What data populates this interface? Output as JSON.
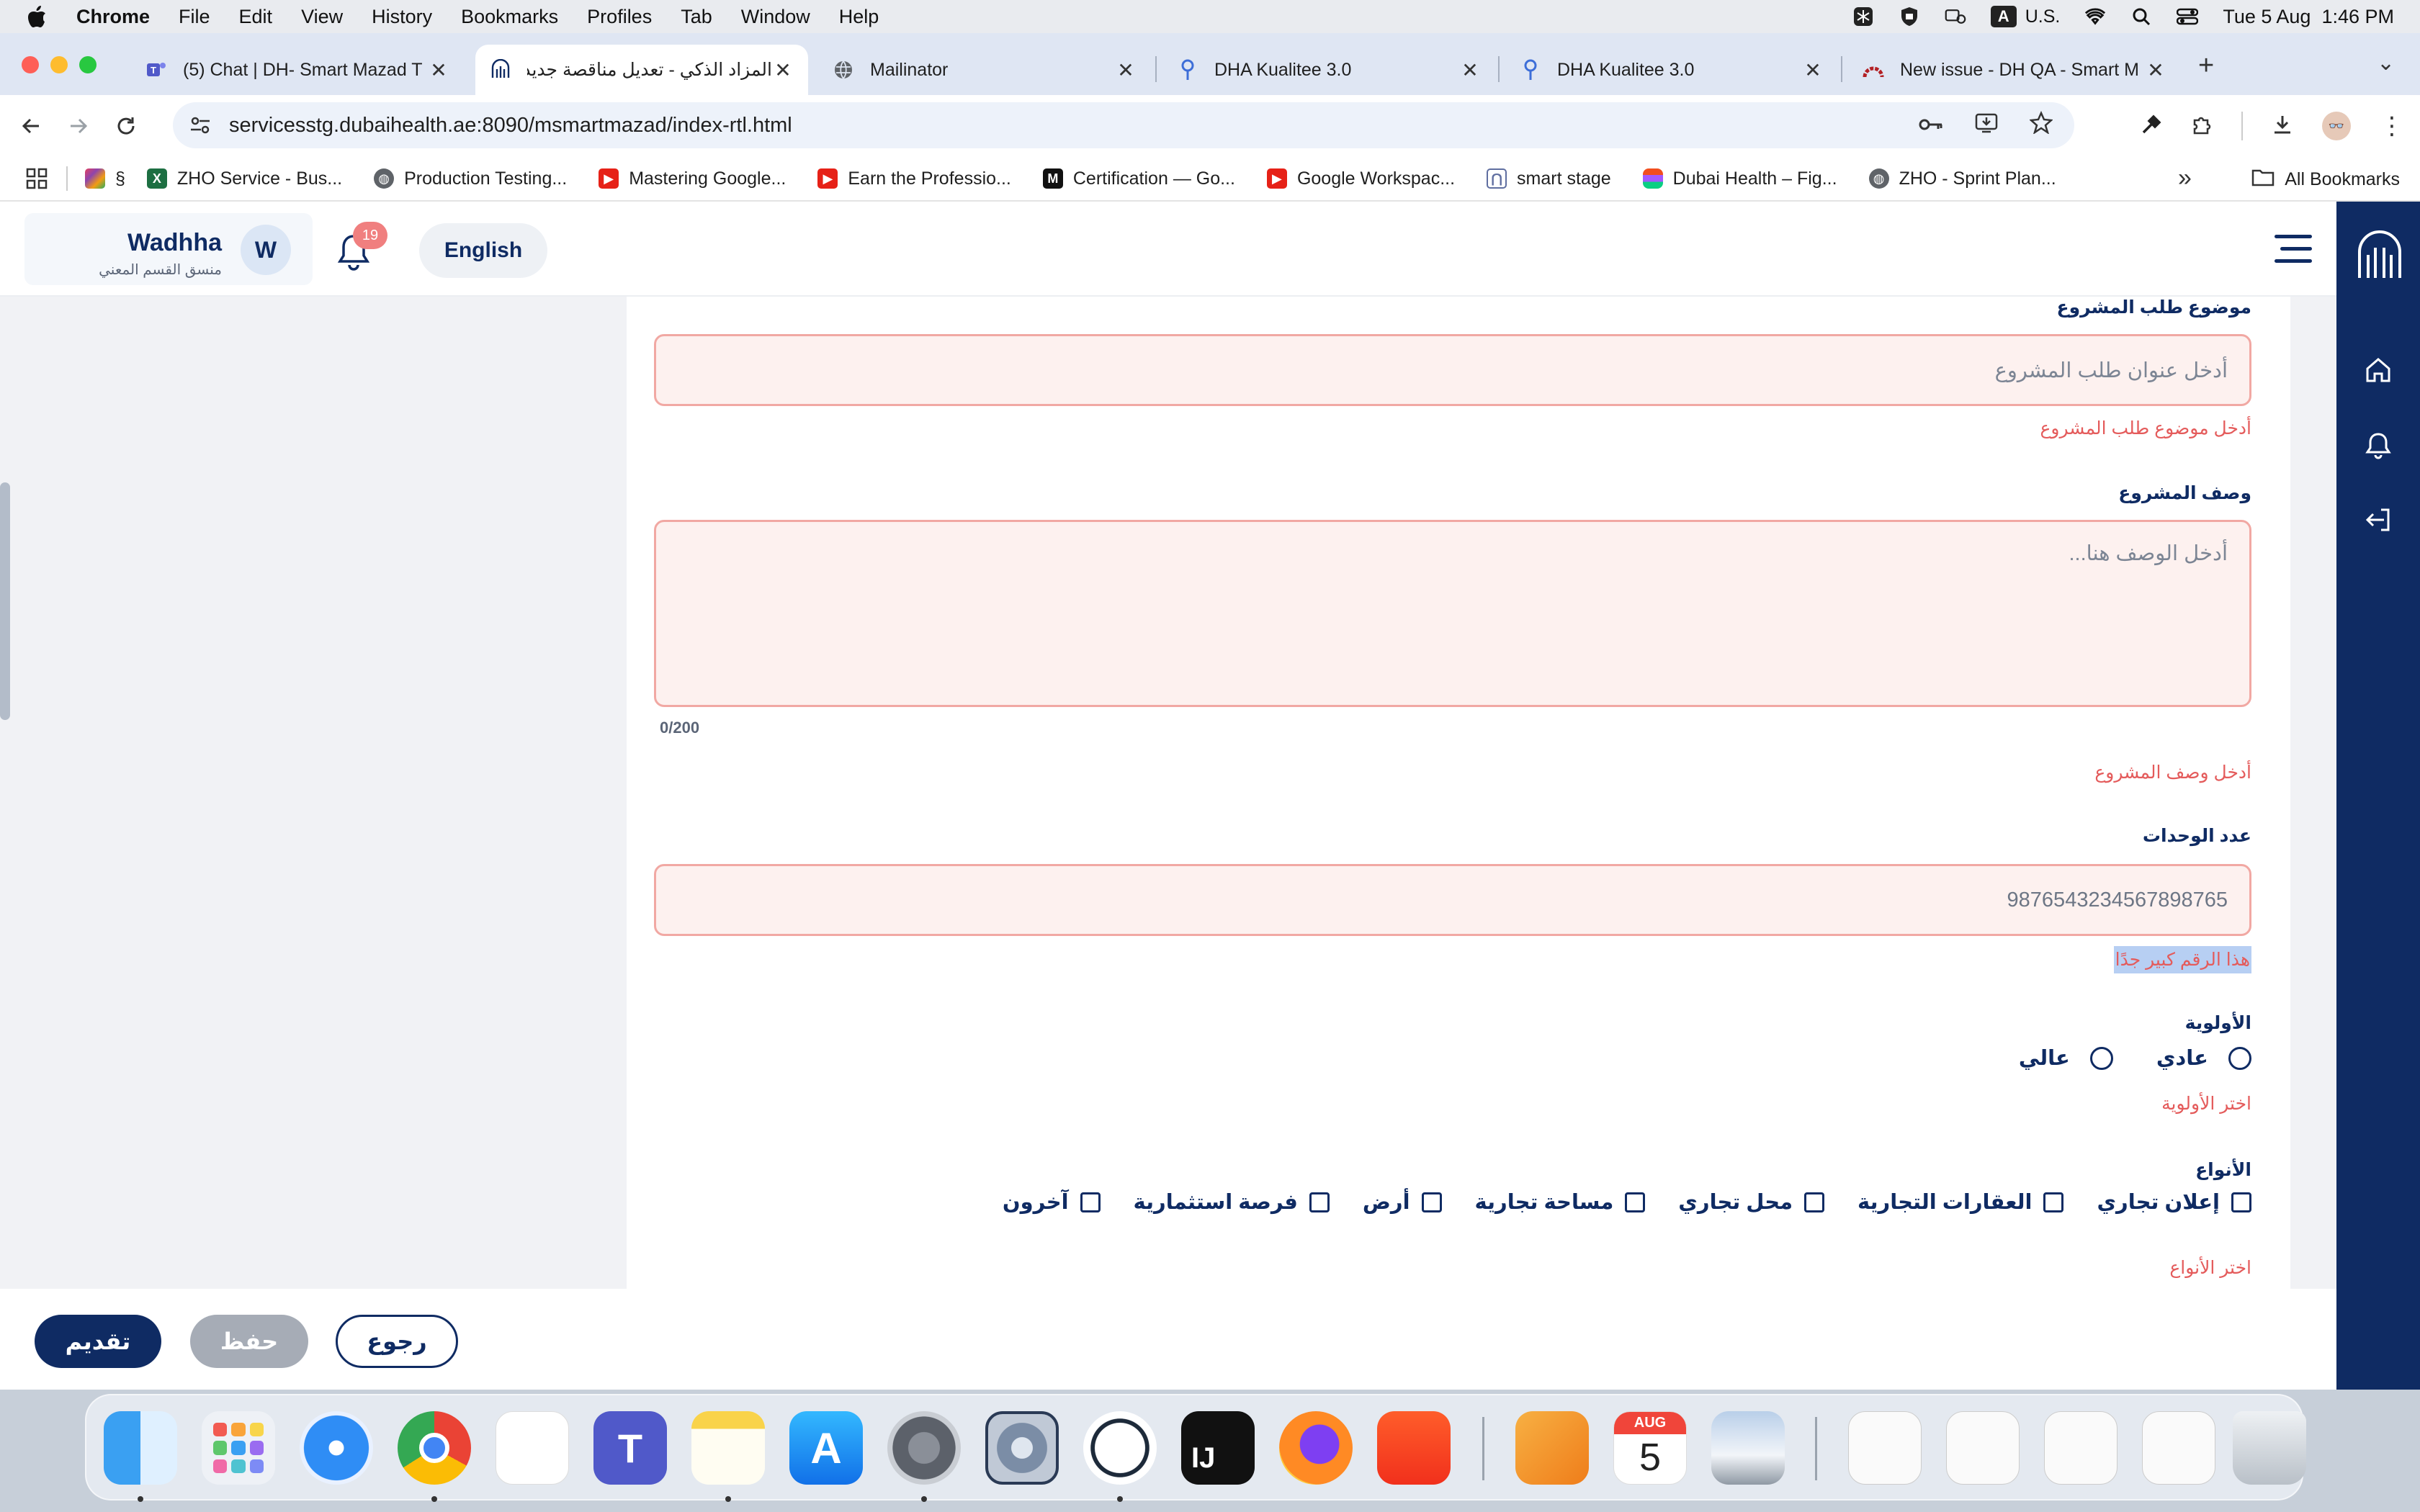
{
  "menubar": {
    "app": "Chrome",
    "items": [
      "File",
      "Edit",
      "View",
      "History",
      "Bookmarks",
      "Profiles",
      "Tab",
      "Window",
      "Help"
    ],
    "input_source": "A",
    "keyboard": "U.S.",
    "clock": "Tue 5 Aug  1:46 PM"
  },
  "tabs": [
    {
      "title": "(5) Chat | DH- Smart Mazad T",
      "icon": "teams-icon",
      "active": false
    },
    {
      "title": "المزاد الذكي - تعديل مناقصة جديد",
      "icon": "dha-icon",
      "active": true
    },
    {
      "title": "Mailinator",
      "icon": "globe-icon",
      "active": false
    },
    {
      "title": "DHA Kualitee 3.0",
      "icon": "kualitee-icon",
      "active": false
    },
    {
      "title": "DHA Kualitee 3.0",
      "icon": "kualitee-icon",
      "active": false
    },
    {
      "title": "New issue - DH QA - Smart M",
      "icon": "redmine-icon",
      "active": false
    }
  ],
  "address": {
    "url": "servicesstg.dubaihealth.ae:8090/msmartmazad/index-rtl.html"
  },
  "bookmarks": {
    "items": [
      {
        "label": "§",
        "icon": "apps-colored-icon"
      },
      {
        "label": "ZHO Service - Bus...",
        "icon": "excel-icon"
      },
      {
        "label": "Production Testing...",
        "icon": "globe-icon"
      },
      {
        "label": "Mastering Google...",
        "icon": "youtube-icon"
      },
      {
        "label": "Earn the Professio...",
        "icon": "youtube-icon"
      },
      {
        "label": "Certification — Go...",
        "icon": "medium-icon"
      },
      {
        "label": "Google Workspac...",
        "icon": "youtube-icon"
      },
      {
        "label": "smart stage",
        "icon": "dha-icon"
      },
      {
        "label": "Dubai Health – Fig...",
        "icon": "figma-icon"
      },
      {
        "label": "ZHO - Sprint Plan...",
        "icon": "globe-icon"
      }
    ],
    "all_label": "All Bookmarks"
  },
  "header": {
    "user_name": "Wadhha",
    "user_role": "منسق القسم المعني",
    "avatar_letter": "W",
    "notifications": "19",
    "language_button": "English"
  },
  "form": {
    "subject_label": "موضوع طلب المشروع",
    "subject_placeholder": "أدخل عنوان طلب المشروع",
    "subject_error": "أدخل موضوع طلب المشروع",
    "description_label": "وصف المشروع",
    "description_placeholder": "أدخل الوصف هنا...",
    "description_counter": "0/200",
    "description_error": "أدخل وصف المشروع",
    "units_label": "عدد الوحدات",
    "units_value": "9876543234567898765",
    "units_error": "هذا الرقم كبير جدًا",
    "priority_label": "الأولوية",
    "priority_options": [
      "عادي",
      "عالي"
    ],
    "priority_error": "اختر الأولوية",
    "types_label": "الأنواع",
    "types_options": [
      "إعلان تجاري",
      "العقارات التجارية",
      "محل تجاري",
      "مساحة تجارية",
      "أرض",
      "فرصة استثمارية",
      "آخرون"
    ],
    "types_error": "اختر الأنواع"
  },
  "footer": {
    "submit": "تقديم",
    "save": "حفظ",
    "back": "رجوع"
  },
  "dock": {
    "calendar_month": "AUG",
    "calendar_day": "5"
  },
  "colors": {
    "brand_navy": "#0f2b63",
    "error_red": "#e45b5b",
    "error_field_bg": "#fdf1ef",
    "error_field_border": "#f1a8a3"
  }
}
